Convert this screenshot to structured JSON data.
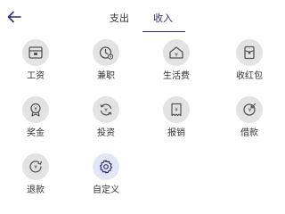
{
  "header": {
    "tabs": [
      {
        "label": "支出",
        "active": false
      },
      {
        "label": "收入",
        "active": true
      }
    ]
  },
  "categories": [
    {
      "label": "工资",
      "icon": "wallet-icon"
    },
    {
      "label": "兼职",
      "icon": "clock-yen-icon"
    },
    {
      "label": "生活费",
      "icon": "house-yen-icon"
    },
    {
      "label": "收红包",
      "icon": "red-envelope-icon"
    },
    {
      "label": "奖金",
      "icon": "medal-yen-icon"
    },
    {
      "label": "投资",
      "icon": "cycle-yen-icon"
    },
    {
      "label": "报销",
      "icon": "receipt-yen-icon"
    },
    {
      "label": "借款",
      "icon": "yen-arrow-icon"
    },
    {
      "label": "退款",
      "icon": "refund-yen-icon"
    },
    {
      "label": "自定义",
      "icon": "gear-icon"
    }
  ],
  "colors": {
    "accent": "#2d2f74",
    "icon_bg": "#e3e3e3",
    "icon_fg": "#555555"
  }
}
